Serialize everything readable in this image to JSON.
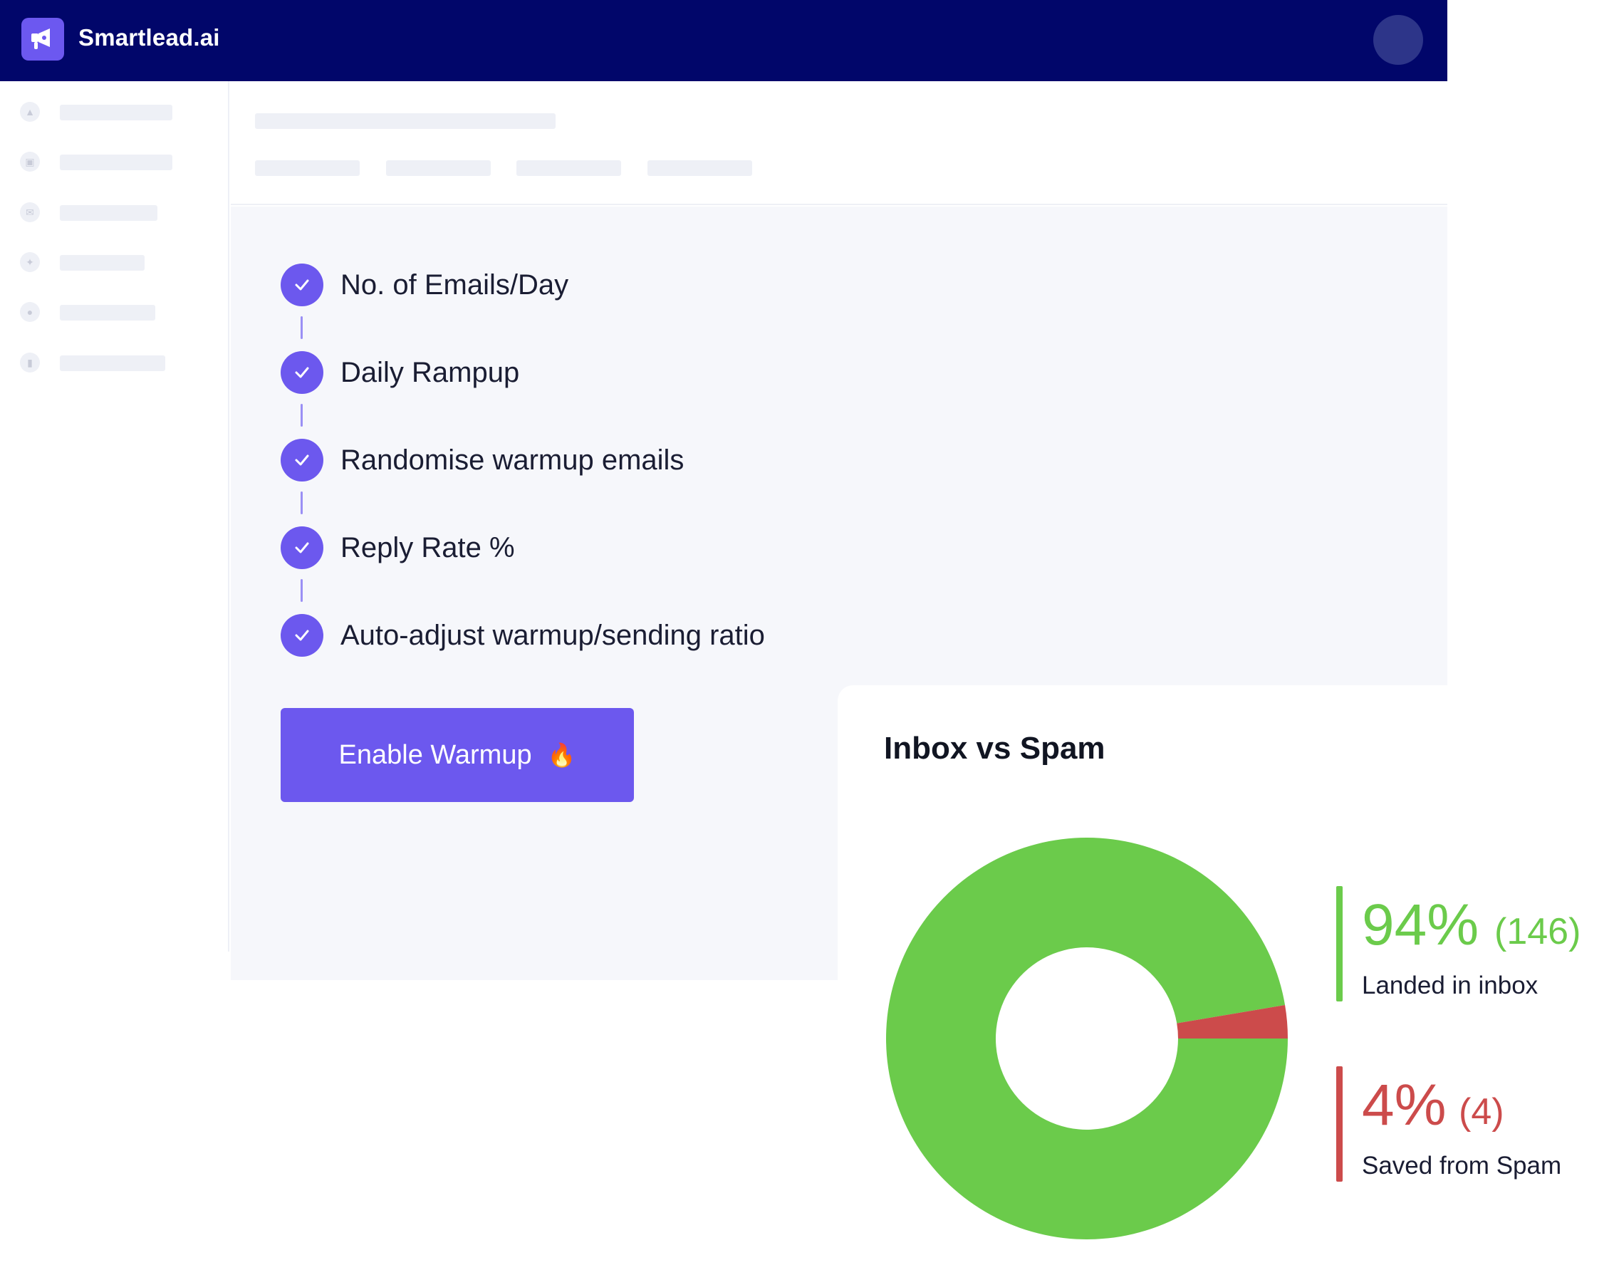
{
  "app": {
    "brand": "Smartlead.ai"
  },
  "colors": {
    "accent": "#6c58ee",
    "topbar": "#01066a",
    "inbox": "#6bcb4b",
    "spam": "#cc4b4b"
  },
  "sidebar": {
    "items": [
      {
        "icon": "megaphone-icon"
      },
      {
        "icon": "inbox-icon"
      },
      {
        "icon": "mail-icon"
      },
      {
        "icon": "puzzle-icon"
      },
      {
        "icon": "user-icon"
      },
      {
        "icon": "bar-chart-icon"
      }
    ]
  },
  "checklist": [
    "No. of Emails/Day",
    "Daily Rampup",
    "Randomise warmup emails",
    "Reply Rate %",
    "Auto-adjust warmup/sending ratio"
  ],
  "enable_button": {
    "label": "Enable Warmup",
    "emoji": "🔥"
  },
  "chart_card": {
    "title": "Inbox vs Spam",
    "inbox": {
      "percent": "94%",
      "count": "(146)",
      "label": "Landed in inbox"
    },
    "spam": {
      "percent": "4%",
      "count": "(4)",
      "label": "Saved from Spam"
    }
  },
  "chart_data": {
    "type": "pie",
    "title": "Inbox vs Spam",
    "categories": [
      "Landed in inbox",
      "Saved from Spam"
    ],
    "values": [
      146,
      4
    ],
    "percent": [
      94,
      4
    ],
    "colors": [
      "#6bcb4b",
      "#cc4b4b"
    ],
    "donut": true
  }
}
